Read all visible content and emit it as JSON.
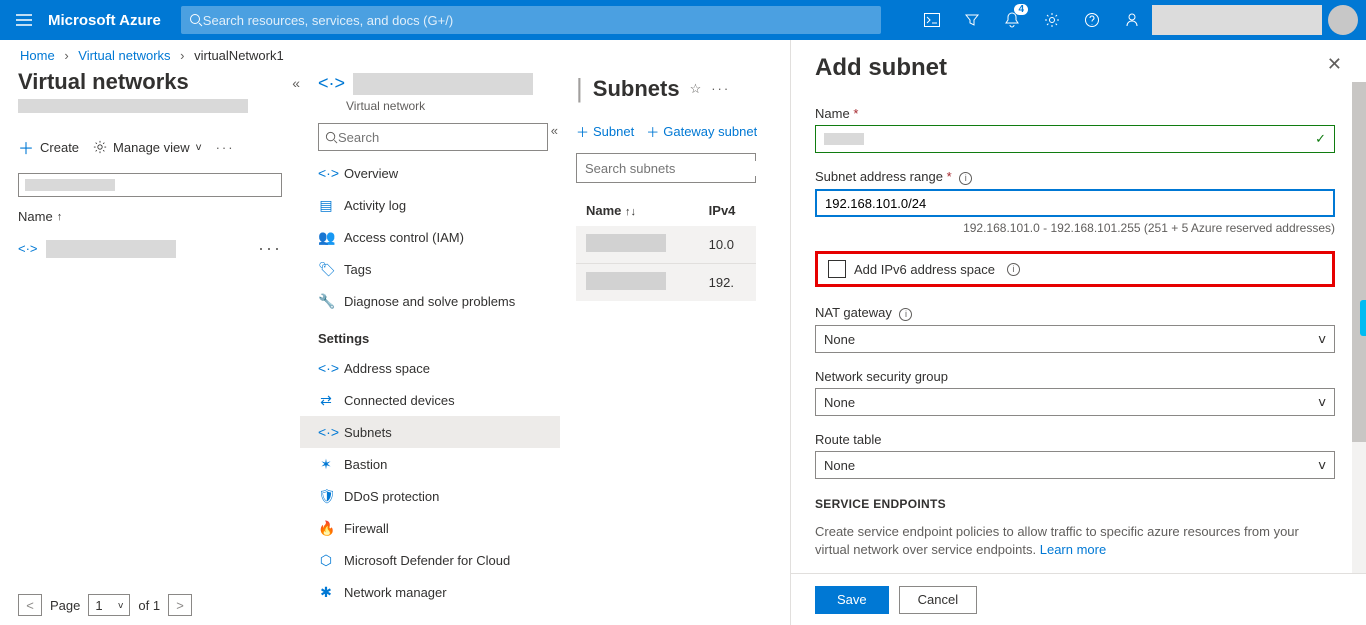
{
  "topbar": {
    "brand": "Microsoft Azure",
    "search_placeholder": "Search resources, services, and docs (G+/)",
    "notification_count": "4"
  },
  "breadcrumb": {
    "home": "Home",
    "vnets": "Virtual networks",
    "current": "virtualNetwork1"
  },
  "col1": {
    "title": "Virtual networks",
    "create": "Create",
    "manage_view": "Manage view",
    "name_hdr": "Name",
    "page_label": "Page",
    "page_num": "1",
    "page_of": "of 1"
  },
  "col2": {
    "subtitle": "Virtual network",
    "search_placeholder": "Search",
    "items": {
      "overview": "Overview",
      "activity": "Activity log",
      "iam": "Access control (IAM)",
      "tags": "Tags",
      "diag": "Diagnose and solve problems",
      "settings_hdr": "Settings",
      "address": "Address space",
      "devices": "Connected devices",
      "subnets": "Subnets",
      "bastion": "Bastion",
      "ddos": "DDoS protection",
      "firewall": "Firewall",
      "defender": "Microsoft Defender for Cloud",
      "netmgr": "Network manager"
    }
  },
  "col3": {
    "pipe": "|",
    "title": "Subnets",
    "btn_subnet": "Subnet",
    "btn_gwsubnet": "Gateway subnet",
    "search_placeholder": "Search subnets",
    "hdr_name": "Name",
    "hdr_ipv4": "IPv4",
    "row1_ipv4": "10.0",
    "row2_ipv4": "192."
  },
  "panel": {
    "title": "Add subnet",
    "name_label": "Name",
    "range_label": "Subnet address range",
    "range_value": "192.168.101.0/24",
    "range_hint": "192.168.101.0 - 192.168.101.255 (251 + 5 Azure reserved addresses)",
    "ipv6_label": "Add IPv6 address space",
    "nat_label": "NAT gateway",
    "nsg_label": "Network security group",
    "route_label": "Route table",
    "none": "None",
    "endpoints_hdr": "SERVICE ENDPOINTS",
    "endpoints_desc": "Create service endpoint policies to allow traffic to specific azure resources from your virtual network over service endpoints.",
    "learn_more": "Learn more",
    "save": "Save",
    "cancel": "Cancel"
  }
}
